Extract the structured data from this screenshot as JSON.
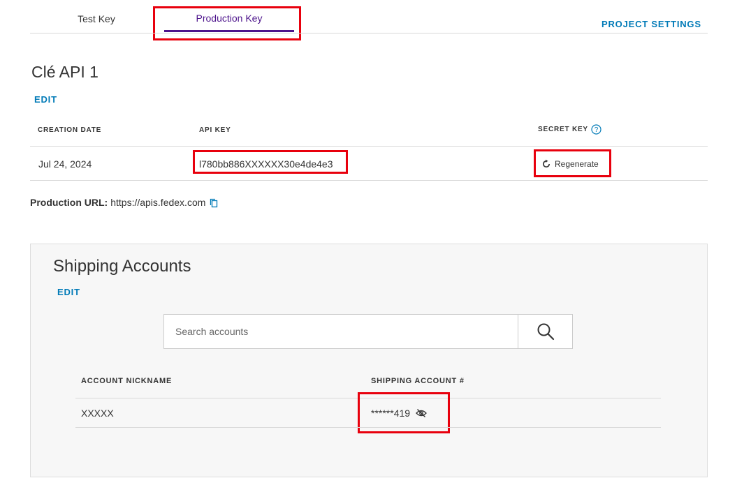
{
  "tabs": [
    {
      "label": "Test Key",
      "active": false
    },
    {
      "label": "Production Key",
      "active": true
    }
  ],
  "project_settings_label": "PROJECT SETTINGS",
  "key_card": {
    "title": "Clé API 1",
    "edit_label": "EDIT",
    "columns": {
      "creation_date": "CREATION DATE",
      "api_key": "API KEY",
      "secret_key": "SECRET KEY"
    },
    "row": {
      "creation_date": "Jul 24, 2024",
      "api_key": "l780bb886XXXXXX30e4de4e3",
      "regenerate_label": "Regenerate"
    },
    "production_url_label": "Production URL:",
    "production_url": "https://apis.fedex.com"
  },
  "shipping": {
    "title": "Shipping Accounts",
    "edit_label": "EDIT",
    "search_placeholder": "Search accounts",
    "columns": {
      "nickname": "ACCOUNT NICKNAME",
      "account_number": "SHIPPING ACCOUNT #"
    },
    "rows": [
      {
        "nickname": "XXXXX",
        "account_number": "******419"
      }
    ]
  },
  "colors": {
    "accent": "#4d148c",
    "link": "#007ab7",
    "highlight": "#e8000d"
  },
  "icons": [
    "help-circle-icon",
    "refresh-icon",
    "copy-icon",
    "search-icon",
    "eye-slash-icon"
  ]
}
